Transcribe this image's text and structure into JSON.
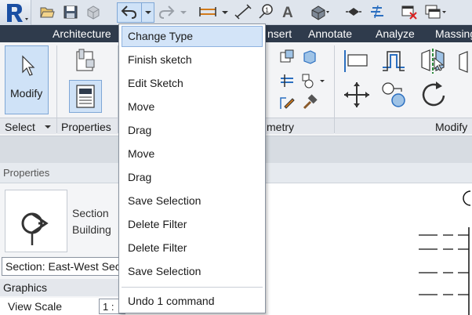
{
  "ribbon_tabs": {
    "architecture": "Architecture",
    "insert": "nsert",
    "annotate": "Annotate",
    "analyze": "Analyze",
    "massing": "Massing"
  },
  "ribbon": {
    "modify_label": "Modify",
    "panels": {
      "select": "Select",
      "properties": "Properties",
      "geometry": "metry",
      "modify": "Modify"
    }
  },
  "properties_palette": {
    "header": "Properties",
    "type_name_line1": "Section",
    "type_name_line2": "Building",
    "type_selector": "Section: East-West Sec",
    "group": "Graphics",
    "param_label": "View Scale",
    "param_value": "1 :"
  },
  "undo_menu": {
    "items": [
      "Change Type",
      "Finish sketch",
      "Edit Sketch",
      "Move",
      "Drag",
      "Move",
      "Drag",
      "Save Selection",
      "Delete Filter",
      "Delete Filter",
      "Save Selection"
    ],
    "selected_index": 0,
    "undo_count_label": "Undo 1 command"
  },
  "colors": {
    "tab_bar": "#2f3b4c",
    "highlight": "#cfe2f7",
    "highlight_border": "#7fa7d6",
    "app_logo": "#1a4fa3"
  },
  "icons": {
    "app_menu": "revit-r-icon",
    "open": "open-folder-icon",
    "save": "save-icon",
    "sync": "sync-cube-icon",
    "undo": "undo-arrow-icon",
    "redo": "redo-arrow-icon",
    "measure": "measure-icon",
    "dimension": "aligned-dimension-icon",
    "tag": "tag-icon",
    "text": "text-icon",
    "3d_view": "default-3d-icon",
    "section": "section-icon",
    "thin_lines": "thin-lines-icon",
    "close_hidden": "close-hidden-windows-icon",
    "switch_windows": "switch-windows-icon"
  }
}
